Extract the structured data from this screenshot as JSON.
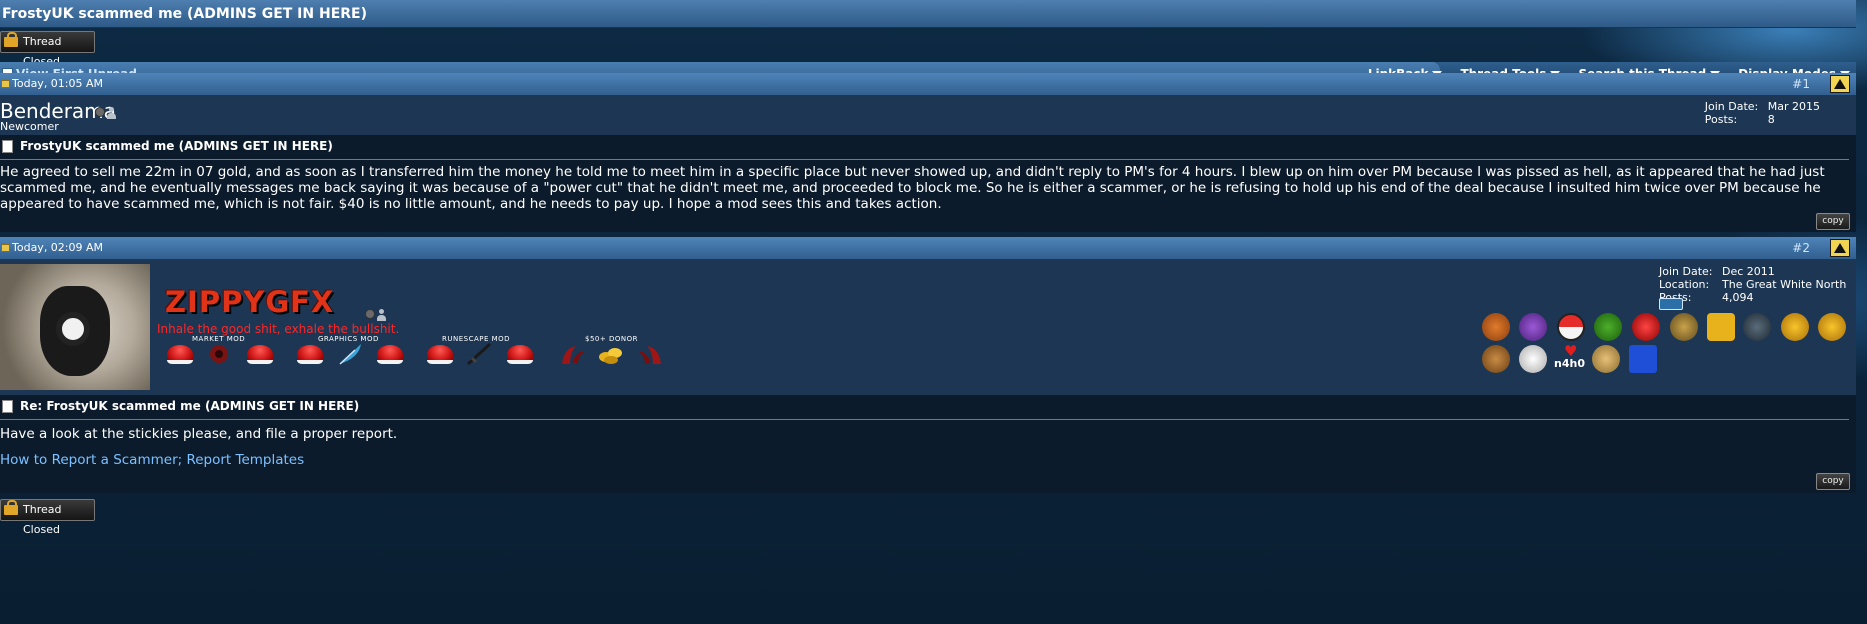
{
  "thread": {
    "title": "FrostyUK scammed me (ADMINS GET IN HERE)",
    "closed_label": "Thread Closed"
  },
  "toolbar": {
    "view_first_unread": "View First Unread",
    "tools": [
      "LinkBack",
      "Thread Tools",
      "Search this Thread",
      "Display Modes"
    ]
  },
  "posts": [
    {
      "time": "Today, 01:05 AM",
      "number": "#1",
      "username": "Benderama",
      "user_title": "Newcomer",
      "join_date_label": "Join Date:",
      "join_date": "Mar 2015",
      "posts_label": "Posts:",
      "posts": "8",
      "title": "FrostyUK scammed me (ADMINS GET IN HERE)",
      "body": "He agreed to sell me 22m in 07 gold, and as soon as I transferred him the money he told me to meet him in a specific place but never showed up, and didn't reply to PM's for 4 hours. I blew up on him over PM because I was pissed as hell, as it appeared that he had just scammed me, and he eventually messages me back saying it was because of a \"power cut\" that he didn't meet me, and proceeded to block me. So he is either a scammer, or he is refusing to hold up his end of the deal because I insulted him twice over PM because he appeared to have scammed me, which is not fair. $40 is no little amount, and he needs to pay up. I hope a mod sees this and takes action.",
      "copy_label": "copy"
    },
    {
      "time": "Today, 02:09 AM",
      "number": "#2",
      "username": "ZIPPYGFX",
      "user_tagline": "Inhale the good shit, exhale the bullshit.",
      "rank_labels": [
        "MARKET MOD",
        "GRAPHICS MOD",
        "RUNESCAPE MOD",
        "$50+ DONOR"
      ],
      "join_date_label": "Join Date:",
      "join_date": "Dec 2011",
      "location_label": "Location:",
      "location": "The Great White North",
      "posts_label": "Posts:",
      "posts": "4,094",
      "title": "Re: FrostyUK scammed me (ADMINS GET IN HERE)",
      "body": "Have a look at the stickies please, and file a proper report.",
      "link": "How to Report a Scammer; Report Templates",
      "copy_label": "copy",
      "badge_text": "n4h0"
    }
  ],
  "colors": {
    "accent": "#315f8f",
    "link": "#7cc0ff",
    "name_red": "#e03318"
  }
}
